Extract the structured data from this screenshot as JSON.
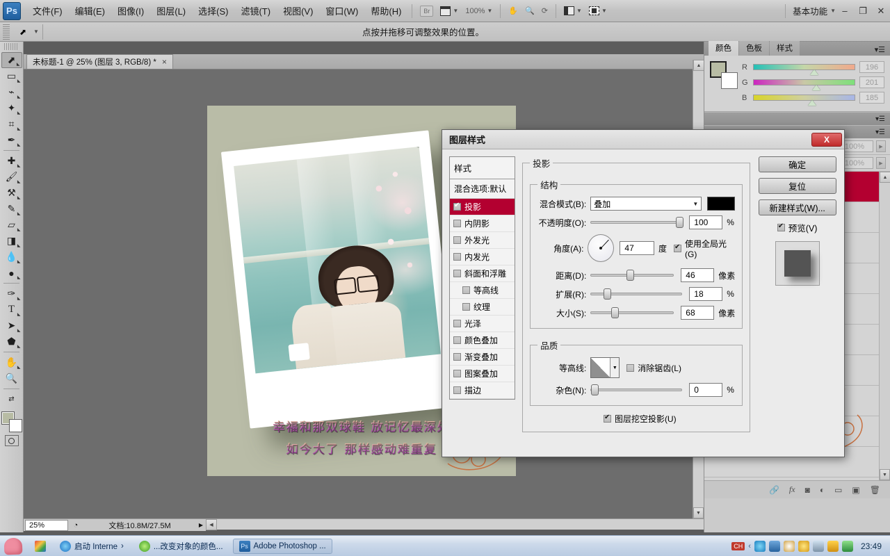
{
  "app": {
    "logo": "Ps",
    "workspace": "基本功能",
    "zoom_display": "100%"
  },
  "menu": {
    "items": [
      "文件(F)",
      "编辑(E)",
      "图像(I)",
      "图层(L)",
      "选择(S)",
      "滤镜(T)",
      "视图(V)",
      "窗口(W)",
      "帮助(H)"
    ],
    "bridge": "Br",
    "minimize": "–",
    "restore": "❐",
    "close": "✕"
  },
  "options_bar": {
    "hint": "点按并拖移可调整效果的位置。"
  },
  "document": {
    "tab_title": "未标题-1 @ 25% (图层 3, RGB/8) *",
    "tab_close": "×"
  },
  "canvas": {
    "caption_line1": "幸福和那双球鞋 放记忆最深处",
    "caption_line2": "如今大了 那样感动难重复"
  },
  "status_bar": {
    "zoom": "25%",
    "doc_info": "文档:10.8M/27.5M"
  },
  "color_panel": {
    "tabs": [
      "颜色",
      "色板",
      "样式"
    ],
    "active_tab": "颜色",
    "channels": [
      {
        "label": "R",
        "value": "196"
      },
      {
        "label": "G",
        "value": "201"
      },
      {
        "label": "B",
        "value": "185"
      }
    ],
    "foreground": "#b8bca4",
    "background": "#ffffff"
  },
  "layers_panel": {
    "opacity_value": "100%",
    "fill_value": "100%",
    "selected_color": "#b30030"
  },
  "dialog": {
    "title": "图层样式",
    "close": "X",
    "styles_header": "样式",
    "blending_options": "混合选项:默认",
    "style_items": [
      {
        "label": "投影",
        "checked": true,
        "active": true,
        "indent": false
      },
      {
        "label": "内阴影",
        "checked": false,
        "active": false,
        "indent": false
      },
      {
        "label": "外发光",
        "checked": false,
        "active": false,
        "indent": false
      },
      {
        "label": "内发光",
        "checked": false,
        "active": false,
        "indent": false
      },
      {
        "label": "斜面和浮雕",
        "checked": false,
        "active": false,
        "indent": false
      },
      {
        "label": "等高线",
        "checked": false,
        "active": false,
        "indent": true
      },
      {
        "label": "纹理",
        "checked": false,
        "active": false,
        "indent": true
      },
      {
        "label": "光泽",
        "checked": false,
        "active": false,
        "indent": false
      },
      {
        "label": "颜色叠加",
        "checked": false,
        "active": false,
        "indent": false
      },
      {
        "label": "渐变叠加",
        "checked": false,
        "active": false,
        "indent": false
      },
      {
        "label": "图案叠加",
        "checked": false,
        "active": false,
        "indent": false
      },
      {
        "label": "描边",
        "checked": false,
        "active": false,
        "indent": false
      }
    ],
    "section_title": "投影",
    "structure_title": "结构",
    "blend_mode_label": "混合模式(B):",
    "blend_mode_value": "叠加",
    "shadow_color": "#000000",
    "opacity_label": "不透明度(O):",
    "opacity_value": "100",
    "opacity_unit": "%",
    "angle_label": "角度(A):",
    "angle_value": "47",
    "angle_unit": "度",
    "global_light_label": "使用全局光(G)",
    "global_light_checked": true,
    "distance_label": "距离(D):",
    "distance_value": "46",
    "distance_unit": "像素",
    "spread_label": "扩展(R):",
    "spread_value": "18",
    "spread_unit": "%",
    "size_label": "大小(S):",
    "size_value": "68",
    "size_unit": "像素",
    "quality_title": "品质",
    "contour_label": "等高线:",
    "antialias_label": "消除锯齿(L)",
    "antialias_checked": false,
    "noise_label": "杂色(N):",
    "noise_value": "0",
    "noise_unit": "%",
    "knockout_label": "图层挖空投影(U)",
    "knockout_checked": true,
    "ok_button": "确定",
    "reset_button": "复位",
    "new_style_button": "新建样式(W)...",
    "preview_label": "预览(V)",
    "preview_checked": true
  },
  "taskbar": {
    "items": [
      {
        "label": "启动 Interne",
        "type": "ie"
      },
      {
        "label": "...改变对象的颜色...",
        "type": "chat"
      },
      {
        "label": "Adobe Photoshop ...",
        "type": "ps",
        "active": true
      }
    ],
    "tray_badge": "CH",
    "clock": "23:49"
  }
}
